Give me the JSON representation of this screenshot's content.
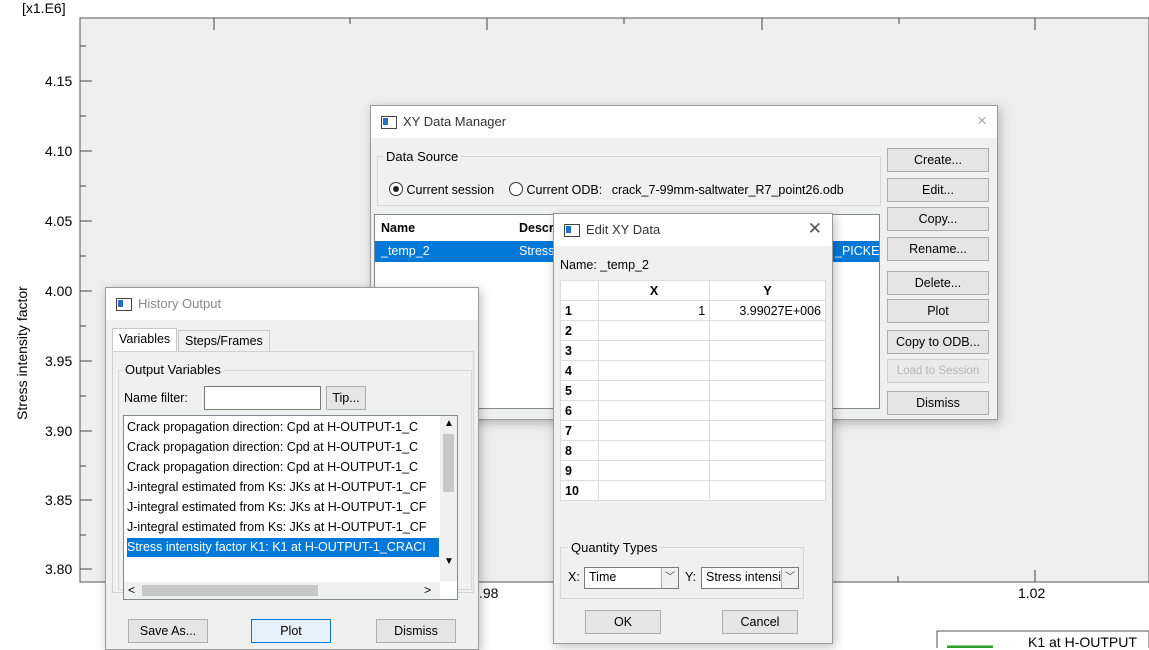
{
  "plot": {
    "y_exponent": "[x1.E6]",
    "ylabel": "Stress intensity factor",
    "y_ticks": [
      "4.15",
      "4.10",
      "4.05",
      "4.00",
      "3.95",
      "3.90",
      "3.85",
      "3.80"
    ],
    "x_ticks": [
      ".98",
      "1.02"
    ],
    "legend_text": "K1 at H-OUTPUT"
  },
  "xy_manager": {
    "title": "XY Data Manager",
    "close": "×",
    "data_source_label": "Data Source",
    "radio_session": "Current session",
    "radio_odb": "Current ODB:",
    "odb_name": "crack_7-99mm-saltwater_R7_point26.odb",
    "col_name": "Name",
    "col_desc": "Descr",
    "row_name": "_temp_2",
    "row_desc": "Stress",
    "row_tail": "_PICKE",
    "buttons": [
      "Create...",
      "Edit...",
      "Copy...",
      "Rename...",
      "Delete...",
      "Plot",
      "Copy to ODB...",
      "Load to Session",
      "Dismiss"
    ]
  },
  "edit_xy": {
    "title": "Edit XY Data",
    "close": "✕",
    "name_label": "Name: _temp_2",
    "col_x": "X",
    "col_y": "Y",
    "rows": [
      {
        "n": "1",
        "x": "1",
        "y": "3.99027E+006"
      },
      {
        "n": "2",
        "x": "",
        "y": ""
      },
      {
        "n": "3",
        "x": "",
        "y": ""
      },
      {
        "n": "4",
        "x": "",
        "y": ""
      },
      {
        "n": "5",
        "x": "",
        "y": ""
      },
      {
        "n": "6",
        "x": "",
        "y": ""
      },
      {
        "n": "7",
        "x": "",
        "y": ""
      },
      {
        "n": "8",
        "x": "",
        "y": ""
      },
      {
        "n": "9",
        "x": "",
        "y": ""
      },
      {
        "n": "10",
        "x": "",
        "y": ""
      }
    ],
    "quantity_types_label": "Quantity Types",
    "x_label": "X:",
    "x_value": "Time",
    "y_label": "Y:",
    "y_value": "Stress intensi",
    "ok": "OK",
    "cancel": "Cancel"
  },
  "history": {
    "title": "History Output",
    "tab_variables": "Variables",
    "tab_steps": "Steps/Frames",
    "output_variables_label": "Output Variables",
    "name_filter_label": "Name filter:",
    "name_filter_value": "",
    "tip_button": "Tip...",
    "items": [
      "Crack propagation direction: Cpd at H-OUTPUT-1_C",
      "Crack propagation direction: Cpd at H-OUTPUT-1_C",
      "Crack propagation direction: Cpd at H-OUTPUT-1_C",
      "J-integral estimated from Ks: JKs at H-OUTPUT-1_CF",
      "J-integral estimated from Ks: JKs at H-OUTPUT-1_CF",
      "J-integral estimated from Ks: JKs at H-OUTPUT-1_CF",
      "Stress intensity factor K1: K1 at H-OUTPUT-1_CRACI"
    ],
    "save_as": "Save As...",
    "plot": "Plot",
    "dismiss": "Dismiss"
  }
}
